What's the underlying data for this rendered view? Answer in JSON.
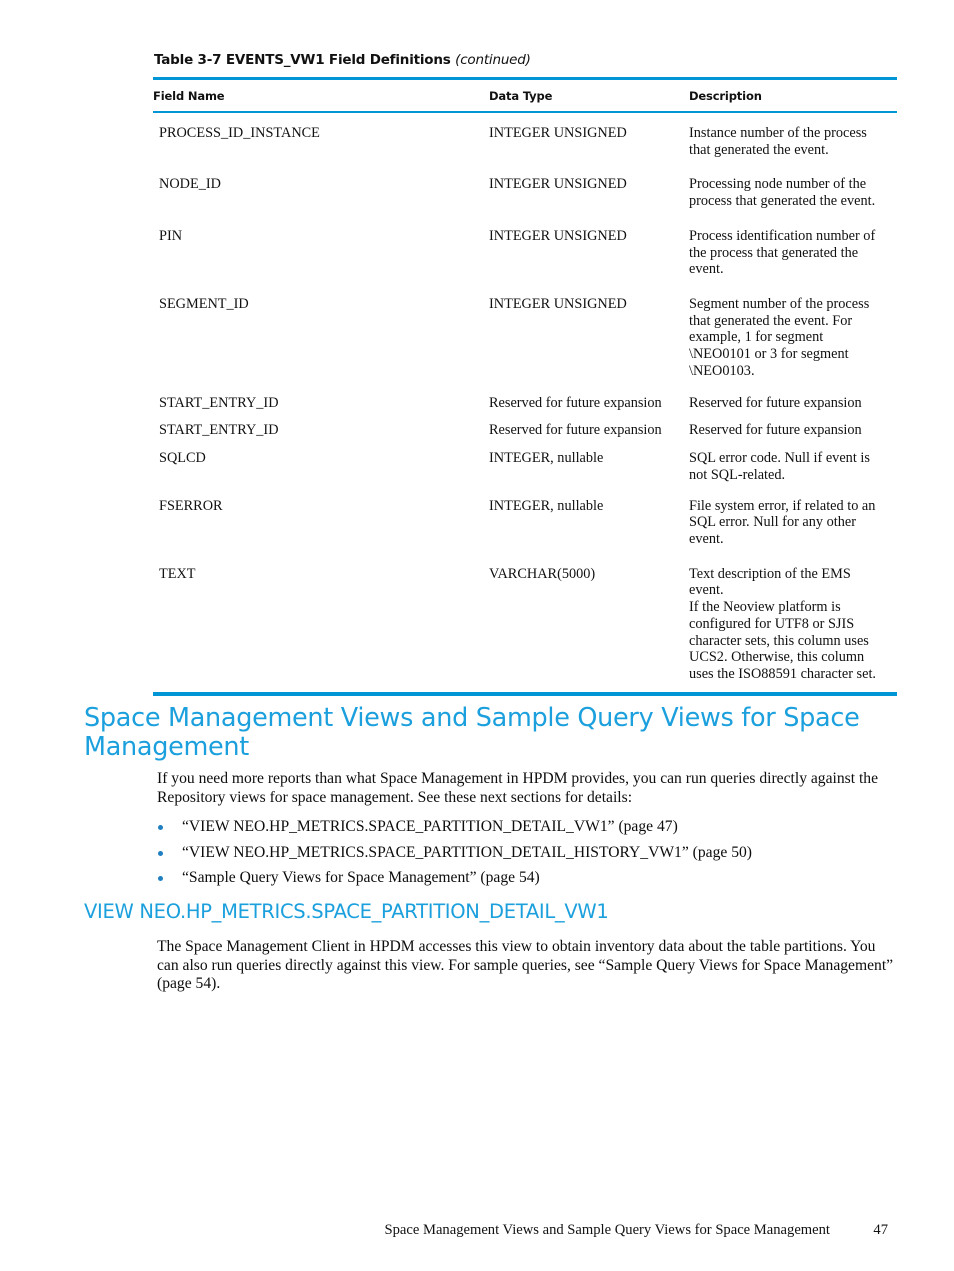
{
  "accent_color": "#0096d6",
  "heading_color": "#1ba0dd",
  "bullet_color": "#1f7fc0",
  "table": {
    "caption_main": "Table 3-7 EVENTS_VW1 Field Definitions",
    "caption_continued": "(continued)",
    "columns": [
      "Field Name",
      "Data Type",
      "Description"
    ],
    "rows": [
      {
        "field": "PROCESS_ID_INSTANCE",
        "type": "INTEGER UNSIGNED",
        "description": "Instance number of the process that generated the event."
      },
      {
        "field": "NODE_ID",
        "type": "INTEGER UNSIGNED",
        "description": "Processing node number of the process that generated the event."
      },
      {
        "field": "PIN",
        "type": "INTEGER UNSIGNED",
        "description": "Process identification number of the process that generated the event."
      },
      {
        "field": "SEGMENT_ID",
        "type": "INTEGER UNSIGNED",
        "description": "Segment number of the process that generated the event. For example, 1 for segment \\NEO0101 or 3 for segment \\NEO0103."
      },
      {
        "field": "START_ENTRY_ID",
        "type": "Reserved for future expansion",
        "description": "Reserved for future expansion"
      },
      {
        "field": "START_ENTRY_ID",
        "type": "Reserved for future expansion",
        "description": "Reserved for future expansion"
      },
      {
        "field": "SQLCD",
        "type": "INTEGER, nullable",
        "description": "SQL error code. Null if event is not SQL-related."
      },
      {
        "field": "FSERROR",
        "type": "INTEGER, nullable",
        "description": "File system error, if related to an SQL error. Null for any other event."
      },
      {
        "field": "TEXT",
        "type": "VARCHAR(5000)",
        "description": "Text description of the EMS event.\nIf the Neoview platform is configured for UTF8 or SJIS character sets, this column uses UCS2. Otherwise, this column uses the ISO88591 character set."
      }
    ]
  },
  "section": {
    "heading": "Space Management Views and Sample Query Views for Space Management",
    "intro": "If you need more reports than what Space Management in HPDM provides, you can run queries directly against the Repository views for space management. See these next sections for details:",
    "links": [
      "“VIEW NEO.HP_METRICS.SPACE_PARTITION_DETAIL_VW1” (page 47)",
      "“VIEW NEO.HP_METRICS.SPACE_PARTITION_DETAIL_HISTORY_VW1” (page 50)",
      "“Sample Query Views for Space Management” (page 54)"
    ]
  },
  "subsection": {
    "heading": "VIEW NEO.HP_METRICS.SPACE_PARTITION_DETAIL_VW1",
    "paragraph": "The Space Management Client in HPDM accesses this view to obtain inventory data about the table partitions. You can also run queries directly against this view. For sample queries, see “Sample Query Views for Space Management” (page 54)."
  },
  "footer": {
    "text": "Space Management Views and Sample Query Views for Space Management",
    "page_number": "47"
  }
}
